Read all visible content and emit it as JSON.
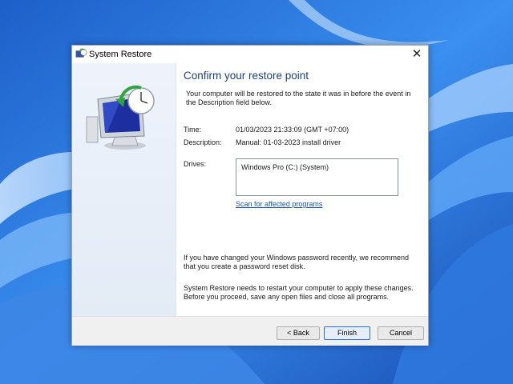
{
  "window": {
    "title": "System Restore",
    "close_glyph": "✕",
    "app_icon": "system-restore-icon"
  },
  "page": {
    "heading": "Confirm your restore point",
    "intro": "Your computer will be restored to the state it was in before the event in the Description field below.",
    "time_label": "Time:",
    "time_value": "01/03/2023 21:33:09 (GMT +07:00)",
    "description_label": "Description:",
    "description_value": "Manual: 01-03-2023 install driver",
    "drives_label": "Drives:",
    "drives": [
      "Windows Pro  (C:) (System)"
    ],
    "scan_link": "Scan for affected programs",
    "password_note": "If you have changed your Windows password recently, we recommend that you create a password reset disk.",
    "restart_note": "System Restore needs to restart your computer to apply these changes. Before you proceed, save any open files and close all programs."
  },
  "buttons": {
    "back": "< Back",
    "finish": "Finish",
    "cancel": "Cancel"
  },
  "colors": {
    "heading": "#1b3f7a",
    "link": "#1a56b0",
    "wallpaper": "#2d7bdc"
  }
}
